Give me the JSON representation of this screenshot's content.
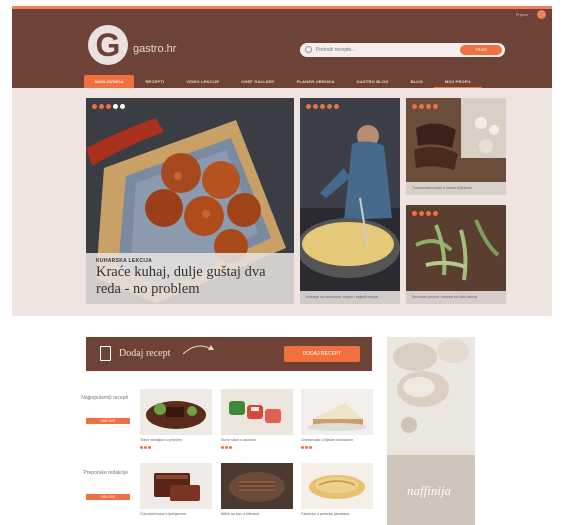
{
  "header": {
    "brand": "gastro.hr",
    "topbar_user": "Prijava",
    "search_placeholder": "Pretraži recepte...",
    "search_button": "TRAŽI",
    "nav": [
      "NASLOVNICA",
      "RECEPTI",
      "VIDEO LEKCIJE",
      "CHEF GALLERY",
      "PLANER OBROKA",
      "GASTRO BLOG",
      "BLOG",
      "MOJ PROFIL"
    ]
  },
  "hero": {
    "main": {
      "tag": "KUHARSKA LEKCIJA",
      "title": "Kraće kuhaj, dulje guštaj dva reda - no problem"
    },
    "cards": [
      {
        "caption": "Kuhanje na otvorenom: savjeti i najbolji recepti"
      },
      {
        "caption": "Tradicionalni kolači iz bakine bilježnice"
      },
      {
        "caption": "Sezonsko povrće: mahune na više načina"
      }
    ]
  },
  "add_recipe": {
    "label": "Dodaj recept",
    "button": "DODAJ RECEPT"
  },
  "sections": [
    {
      "label": "Najpopularniji recepti",
      "button": "VIDI SVE",
      "items": [
        {
          "title": "Teleći medaljoni s povrćem"
        },
        {
          "title": "Sushi rolice s lososom"
        },
        {
          "title": "Cheesecake s bijelom čokoladom"
        }
      ]
    },
    {
      "label": "Preporuke redakcije",
      "button": "VIDI SVE",
      "items": [
        {
          "title": "Čokoladni kolač s lješnjacima"
        },
        {
          "title": "Biftek na žaru s bilinama"
        },
        {
          "title": "Palačinke s pečenim jabukama"
        }
      ]
    }
  ],
  "ad": {
    "text": "naffinija"
  },
  "colors": {
    "header_brown": "#6e4236",
    "accent_orange": "#f07040",
    "hero_background": "#efe4df"
  }
}
